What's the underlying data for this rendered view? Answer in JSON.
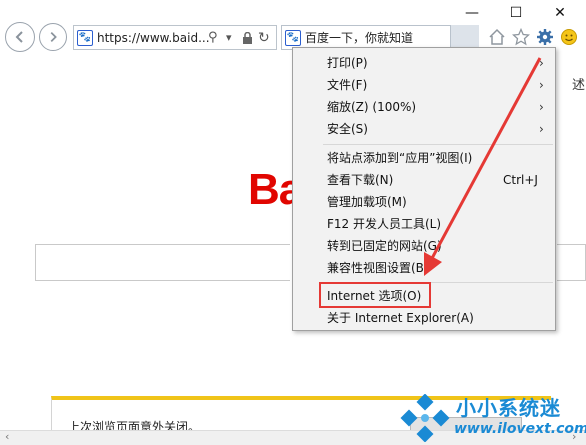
{
  "window": {
    "minimize_glyph": "—",
    "maximize_glyph": "☐",
    "close_glyph": "✕"
  },
  "toolbar": {
    "address_url": "https://www.baid...",
    "search_glyph": "⚲",
    "dropdown_glyph": "▾",
    "lock_glyph": "🔒",
    "refresh_glyph": "↻",
    "tab_title": "百度一下，你就知道",
    "tab_close": "×",
    "icons": [
      "home-icon",
      "favorites-star-icon",
      "tools-gear-icon",
      "feedback-smiley-icon"
    ]
  },
  "page": {
    "logo_text": "Bai",
    "notification_text": "上次浏览页面意外关闭。",
    "partial_right_glyph": "述"
  },
  "menu": {
    "items": [
      {
        "label": "打印(P)",
        "shortcut": "",
        "submenu": true
      },
      {
        "label": "文件(F)",
        "shortcut": "",
        "submenu": true
      },
      {
        "label": "缩放(Z) (100%)",
        "shortcut": "",
        "submenu": true
      },
      {
        "label": "安全(S)",
        "shortcut": "",
        "submenu": true
      },
      {
        "label": "将站点添加到“应用”视图(I)",
        "shortcut": "",
        "submenu": false
      },
      {
        "label": "查看下载(N)",
        "shortcut": "Ctrl+J",
        "submenu": false
      },
      {
        "label": "管理加载项(M)",
        "shortcut": "",
        "submenu": false
      },
      {
        "label": "F12 开发人员工具(L)",
        "shortcut": "",
        "submenu": false
      },
      {
        "label": "转到已固定的网站(G)",
        "shortcut": "",
        "submenu": false
      },
      {
        "label": "兼容性视图设置(B)",
        "shortcut": "",
        "submenu": false
      },
      {
        "label": "Internet 选项(O)",
        "shortcut": "",
        "submenu": false
      },
      {
        "label": "关于 Internet Explorer(A)",
        "shortcut": "",
        "submenu": false
      }
    ],
    "arrow_glyph": "›"
  },
  "watermark": {
    "title": "小小系统迷",
    "url": "www.ilovext.com"
  },
  "colors": {
    "accent_red": "#e53935",
    "baidu_red": "#e10601",
    "watermark_blue": "#1a8ad4",
    "menu_bg": "#f2f2f2"
  }
}
